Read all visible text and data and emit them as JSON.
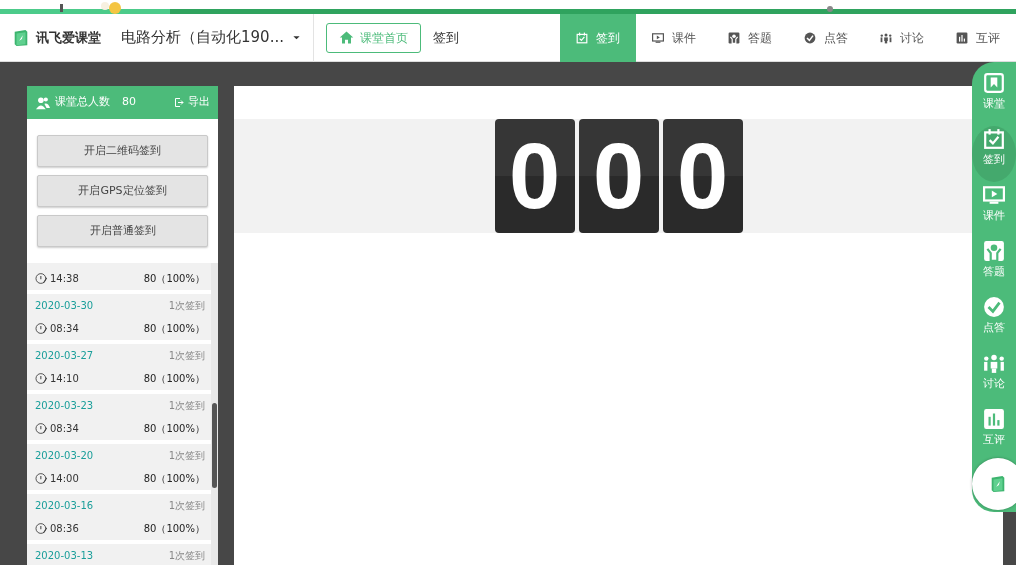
{
  "header": {
    "logo_text": "讯飞爱课堂",
    "course": "电路分析（自动化190...",
    "home_button": "课堂首页",
    "page_title": "签到"
  },
  "tabs": [
    {
      "label": "签到",
      "selected": true
    },
    {
      "label": "课件",
      "selected": false
    },
    {
      "label": "答题",
      "selected": false
    },
    {
      "label": "点答",
      "selected": false
    },
    {
      "label": "讨论",
      "selected": false
    },
    {
      "label": "互评",
      "selected": false
    }
  ],
  "panel": {
    "total_label": "课堂总人数",
    "total": "80",
    "export": "导出",
    "buttons": [
      "开启二维码签到",
      "开启GPS定位签到",
      "开启普通签到"
    ],
    "records": [
      {
        "time": "14:38",
        "attendance": "80（100%）"
      },
      {
        "date": "2020-03-30",
        "count": "1次签到",
        "time": "08:34",
        "attendance": "80（100%）"
      },
      {
        "date": "2020-03-27",
        "count": "1次签到",
        "time": "14:10",
        "attendance": "80（100%）"
      },
      {
        "date": "2020-03-23",
        "count": "1次签到",
        "time": "08:34",
        "attendance": "80（100%）"
      },
      {
        "date": "2020-03-20",
        "count": "1次签到",
        "time": "14:00",
        "attendance": "80（100%）"
      },
      {
        "date": "2020-03-16",
        "count": "1次签到",
        "time": "08:36",
        "attendance": "80（100%）"
      },
      {
        "date": "2020-03-13",
        "count": "1次签到"
      }
    ]
  },
  "counter": {
    "digits": [
      "0",
      "0",
      "0"
    ]
  },
  "rail": [
    {
      "label": "课堂",
      "selected": false
    },
    {
      "label": "签到",
      "selected": true
    },
    {
      "label": "课件",
      "selected": false
    },
    {
      "label": "答题",
      "selected": false
    },
    {
      "label": "点答",
      "selected": false
    },
    {
      "label": "讨论",
      "selected": false
    },
    {
      "label": "互评",
      "selected": false
    }
  ]
}
